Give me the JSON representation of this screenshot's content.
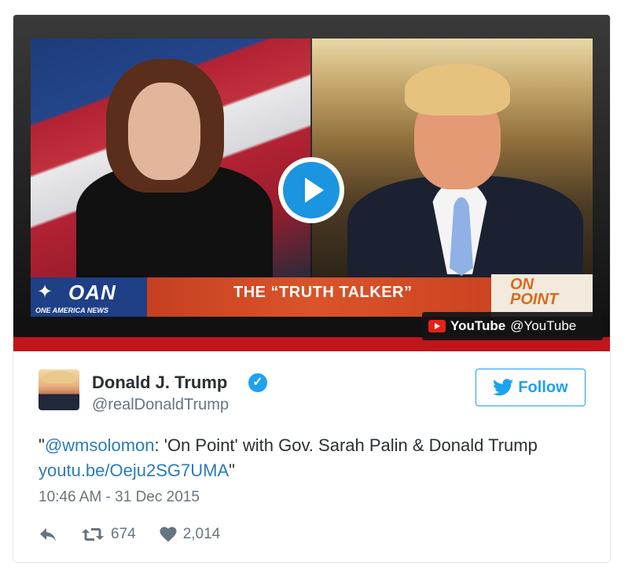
{
  "media": {
    "banner_title": "THE “TRUTH TALKER”",
    "network_logo": "OAN",
    "network_subtitle": "ONE AMERICA NEWS",
    "show_logo_line1": "ON",
    "show_logo_line2": "POINT",
    "source_brand": "YouTube",
    "source_handle": "@YouTube",
    "play_icon": "play-button-icon"
  },
  "tweet": {
    "author_name": "Donald J. Trump",
    "author_handle": "@realDonaldTrump",
    "verified_icon": "verified-badge-icon",
    "follow_label": "Follow",
    "text_prefix": "\"",
    "mention": "@wmsolomon",
    "text_body": ": 'On Point' with Gov. Sarah Palin & Donald Trump ",
    "link": "youtu.be/Oeju2SG7UMA",
    "text_suffix": "\"",
    "timestamp": "10:46 AM - 31 Dec 2015",
    "retweet_count": "674",
    "like_count": "2,014"
  },
  "colors": {
    "link": "#2b7bb9",
    "accent": "#1da1f2",
    "muted": "#66757f"
  }
}
